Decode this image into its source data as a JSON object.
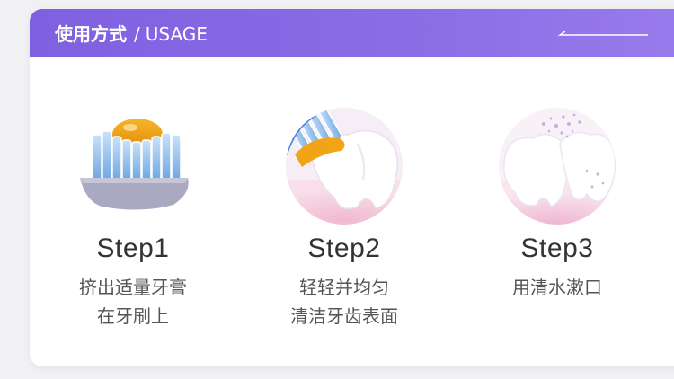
{
  "header": {
    "title_cn": "使用方式",
    "separator": "/",
    "title_en": "USAGE"
  },
  "steps": [
    {
      "label": "Step1",
      "desc_line1": "挤出适量牙膏",
      "desc_line2": "在牙刷上",
      "icon": "toothbrush-with-toothpaste-icon"
    },
    {
      "label": "Step2",
      "desc_line1": "轻轻并均匀",
      "desc_line2": "清洁牙齿表面",
      "icon": "brushing-teeth-icon"
    },
    {
      "label": "Step3",
      "desc_line1": "用清水漱口",
      "desc_line2": "",
      "icon": "rinsing-teeth-icon"
    }
  ],
  "colors": {
    "header_gradient_start": "#7f60e0",
    "header_gradient_end": "#9a7bec",
    "bristle_blue": "#8fc0ee",
    "paste_orange": "#f2a417",
    "tooth_white": "#ffffff",
    "gum_pink": "#f4c9dc"
  }
}
